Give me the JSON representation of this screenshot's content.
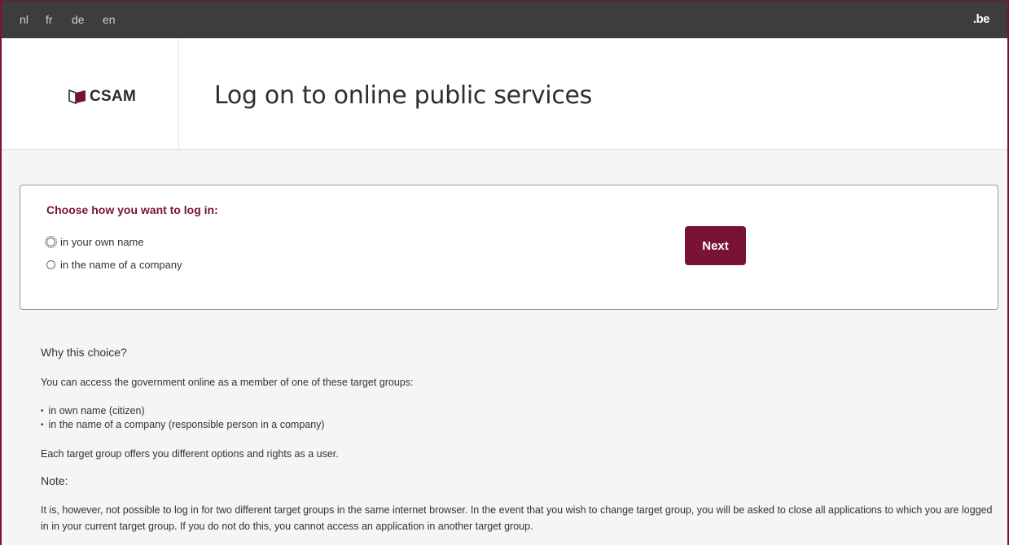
{
  "topbar": {
    "languages": [
      {
        "code": "nl",
        "active": false
      },
      {
        "code": "fr",
        "active": true
      },
      {
        "code": "de",
        "active": false
      },
      {
        "code": "en",
        "active": false
      }
    ],
    "brand": ".be"
  },
  "header": {
    "logo_text": "CSAM",
    "title": "Log on to online public services"
  },
  "login_choice": {
    "title": "Choose how you want to log in:",
    "options": [
      {
        "label": "in your own name",
        "selected": false,
        "focused": true
      },
      {
        "label": "in the name of a company",
        "selected": false,
        "focused": false
      }
    ],
    "next_label": "Next"
  },
  "info": {
    "heading": "Why this choice?",
    "intro": "You can access the government online as a member of one of these target groups:",
    "groups": [
      "in own name (citizen)",
      "in the name of a company (responsible person in a company)"
    ],
    "options_text": "Each target group offers you different options and rights as a user.",
    "note_heading": "Note:",
    "note_text": "It is, however, not possible to log in for two different target groups in the same internet browser. In the event that you wish to change target group, you will be asked to close all applications to which you are logged in in your current target group. If you do not do this, you cannot access an application in another target group."
  },
  "colors": {
    "topbar": "#3d3d3d",
    "accent": "#7a1235",
    "background": "#f5f5f5"
  }
}
